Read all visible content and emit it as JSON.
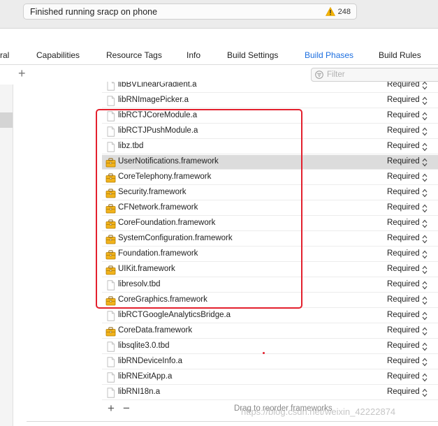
{
  "status": {
    "text": "Finished running sracp on phone",
    "warning_count": "248",
    "warning_color": "#f5b400"
  },
  "tabs": [
    {
      "label": "ral",
      "active": false
    },
    {
      "label": "Capabilities",
      "active": false
    },
    {
      "label": "Resource Tags",
      "active": false
    },
    {
      "label": "Info",
      "active": false
    },
    {
      "label": "Build Settings",
      "active": false
    },
    {
      "label": "Build Phases",
      "active": true
    },
    {
      "label": "Build Rules",
      "active": false
    }
  ],
  "filter": {
    "placeholder": "Filter"
  },
  "frameworks": [
    {
      "name": "libBVLinearGradient.a",
      "status": "Required",
      "icon": "file-icon",
      "selected": false
    },
    {
      "name": "libRNImagePicker.a",
      "status": "Required",
      "icon": "file-icon",
      "selected": false
    },
    {
      "name": "libRCTJCoreModule.a",
      "status": "Required",
      "icon": "file-icon",
      "selected": false
    },
    {
      "name": "libRCTJPushModule.a",
      "status": "Required",
      "icon": "file-icon",
      "selected": false
    },
    {
      "name": "libz.tbd",
      "status": "Required",
      "icon": "file-icon",
      "selected": false
    },
    {
      "name": "UserNotifications.framework",
      "status": "Required",
      "icon": "framework-icon",
      "selected": true
    },
    {
      "name": "CoreTelephony.framework",
      "status": "Required",
      "icon": "framework-icon",
      "selected": false
    },
    {
      "name": "Security.framework",
      "status": "Required",
      "icon": "framework-icon",
      "selected": false
    },
    {
      "name": "CFNetwork.framework",
      "status": "Required",
      "icon": "framework-icon",
      "selected": false
    },
    {
      "name": "CoreFoundation.framework",
      "status": "Required",
      "icon": "framework-icon",
      "selected": false
    },
    {
      "name": "SystemConfiguration.framework",
      "status": "Required",
      "icon": "framework-icon",
      "selected": false
    },
    {
      "name": "Foundation.framework",
      "status": "Required",
      "icon": "framework-icon",
      "selected": false
    },
    {
      "name": "UIKit.framework",
      "status": "Required",
      "icon": "framework-icon",
      "selected": false
    },
    {
      "name": "libresolv.tbd",
      "status": "Required",
      "icon": "file-icon",
      "selected": false
    },
    {
      "name": "CoreGraphics.framework",
      "status": "Required",
      "icon": "framework-icon",
      "selected": false
    },
    {
      "name": "libRCTGoogleAnalyticsBridge.a",
      "status": "Required",
      "icon": "file-icon",
      "selected": false
    },
    {
      "name": "CoreData.framework",
      "status": "Required",
      "icon": "framework-icon",
      "selected": false
    },
    {
      "name": "libsqlite3.0.tbd",
      "status": "Required",
      "icon": "file-icon",
      "selected": false
    },
    {
      "name": "libRNDeviceInfo.a",
      "status": "Required",
      "icon": "file-icon",
      "selected": false
    },
    {
      "name": "libRNExitApp.a",
      "status": "Required",
      "icon": "file-icon",
      "selected": false
    },
    {
      "name": "libRNI18n.a",
      "status": "Required",
      "icon": "file-icon",
      "selected": false
    }
  ],
  "bottom": {
    "add": "+",
    "remove": "−",
    "drag_hint": "Drag to reorder frameworks"
  },
  "watermark": "https://blog.csdn.net/weixin_42222874",
  "highlight_color": "#e3202d",
  "accent_color": "#1d6fe0"
}
